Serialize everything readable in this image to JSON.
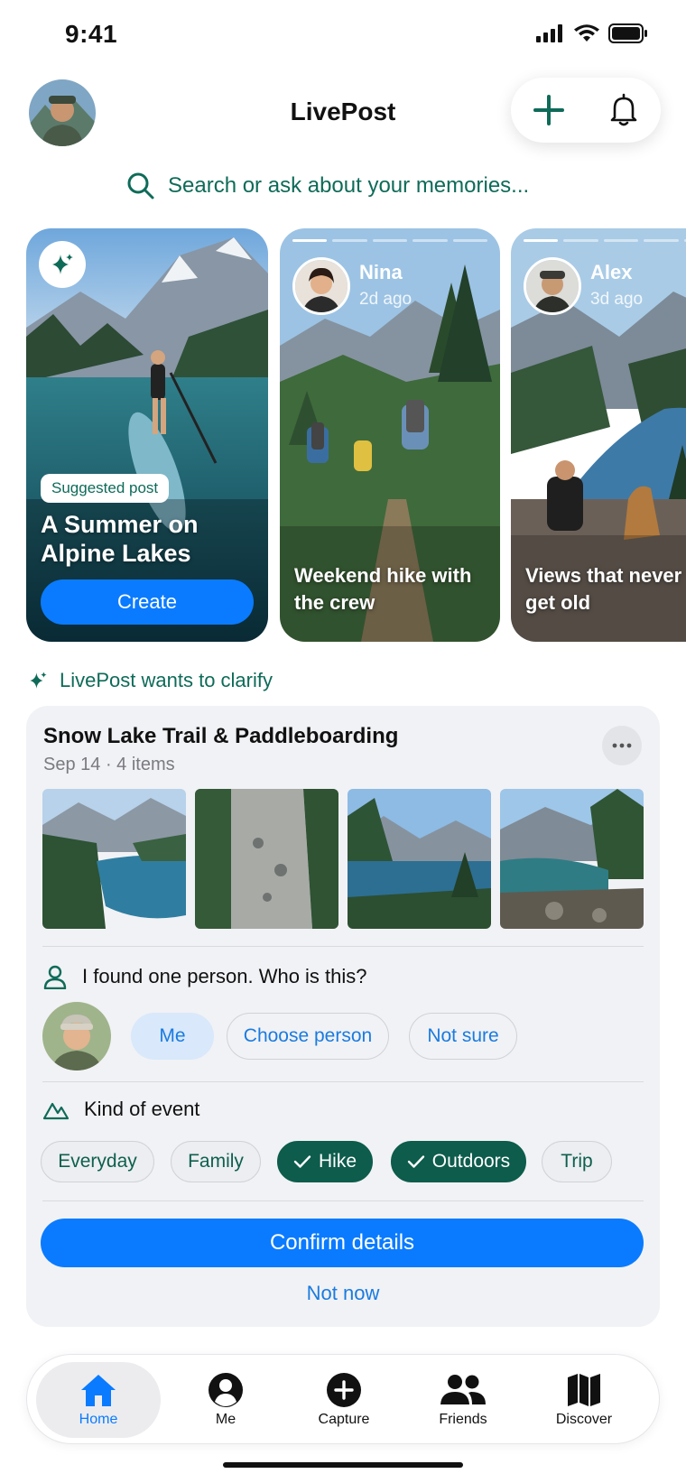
{
  "status_bar": {
    "time": "9:41"
  },
  "header": {
    "title": "LivePost"
  },
  "search": {
    "placeholder": "Search or ask about your memories..."
  },
  "stories": {
    "suggested": {
      "badge": "Suggested post",
      "title": "A Summer on Alpine Lakes",
      "button": "Create"
    },
    "friends": [
      {
        "name": "Nina",
        "time": "2d ago",
        "caption": "Weekend hike with the crew"
      },
      {
        "name": "Alex",
        "time": "3d ago",
        "caption": "Views that never get old"
      }
    ]
  },
  "clarify": {
    "heading": "LivePost wants to clarify",
    "event_title": "Snow Lake Trail & Paddleboarding",
    "event_meta": "Sep 14 · 4 items",
    "person_question": "I found one person. Who is this?",
    "person_options": [
      "Me",
      "Choose person",
      "Not sure"
    ],
    "event_question": "Kind of event",
    "event_tags": [
      {
        "label": "Everyday",
        "selected": false
      },
      {
        "label": "Family",
        "selected": false
      },
      {
        "label": "Hike",
        "selected": true
      },
      {
        "label": "Outdoors",
        "selected": true
      },
      {
        "label": "Trip",
        "selected": false
      }
    ],
    "confirm": "Confirm details",
    "dismiss": "Not now"
  },
  "tabbar": {
    "items": [
      {
        "label": "Home",
        "icon": "home-icon",
        "active": true
      },
      {
        "label": "Me",
        "icon": "person-circle-icon",
        "active": false
      },
      {
        "label": "Capture",
        "icon": "plus-circle-icon",
        "active": false
      },
      {
        "label": "Friends",
        "icon": "people-icon",
        "active": false
      },
      {
        "label": "Discover",
        "icon": "map-icon",
        "active": false
      }
    ]
  },
  "colors": {
    "accent": "#0a7bff",
    "brand_green": "#0e6b58",
    "selected_chip": "#0d5c4c"
  }
}
